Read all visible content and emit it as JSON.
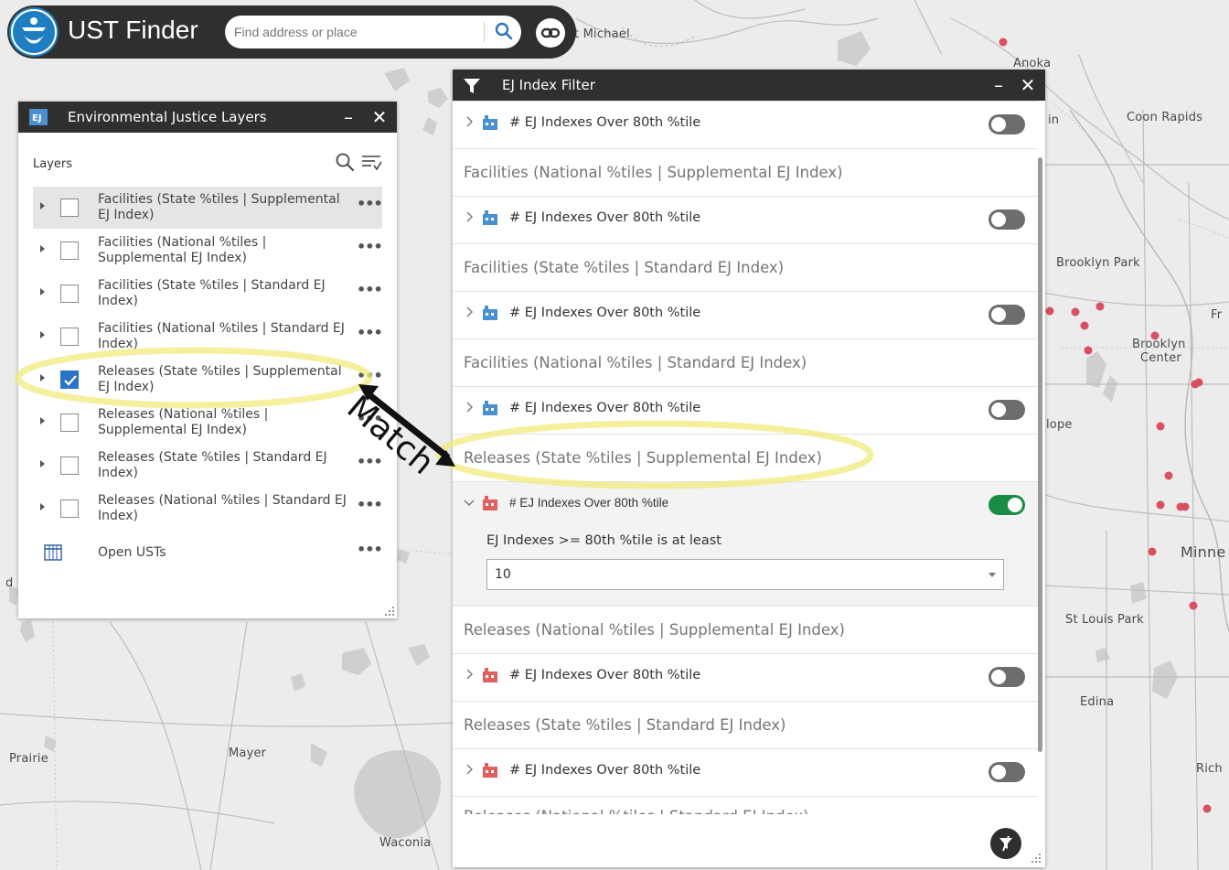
{
  "app": {
    "title": "UST Finder",
    "search_placeholder": "Find address or place"
  },
  "map": {
    "labels": [
      {
        "name": "Saint Michael",
        "text": "t Michael"
      },
      {
        "name": "Anoka",
        "text": "Anoka"
      },
      {
        "name": "Coon Rapids",
        "text": "Coon Rapids"
      },
      {
        "name": "partial-in",
        "text": "in"
      },
      {
        "name": "Brooklyn Park",
        "text": "Brooklyn Park"
      },
      {
        "name": "partial-fr",
        "text": "Fr"
      },
      {
        "name": "Brooklyn Center line 1",
        "text": "Brooklyn"
      },
      {
        "name": "Brooklyn Center line 2",
        "text": "Center"
      },
      {
        "name": "New Hope partial",
        "text": "lope"
      },
      {
        "name": "Minneapolis partial",
        "text": "Minne"
      },
      {
        "name": "St Louis Park",
        "text": "St Louis Park"
      },
      {
        "name": "Edina",
        "text": "Edina"
      },
      {
        "name": "Richfield partial",
        "text": "Rich"
      },
      {
        "name": "Mayer",
        "text": "Mayer"
      },
      {
        "name": "Prairie partial",
        "text": "Prairie"
      },
      {
        "name": "Waconia",
        "text": "Waconia"
      },
      {
        "name": "partial-d",
        "text": "d"
      }
    ],
    "point_color": "#d9505f"
  },
  "layers_panel": {
    "title": "Environmental Justice Layers",
    "logo_text": "EJ",
    "minimize": "–",
    "close": "✕",
    "section_label": "Layers",
    "layers": [
      {
        "label": "Facilities (State %tiles | Supplemental EJ Index)",
        "checked": false
      },
      {
        "label": "Facilities (National %tiles | Supplemental EJ Index)",
        "checked": false
      },
      {
        "label": "Facilities (State %tiles | Standard EJ Index)",
        "checked": false
      },
      {
        "label": "Facilities (National %tiles | Standard EJ Index)",
        "checked": false
      },
      {
        "label": "Releases (State %tiles | Supplemental EJ Index)",
        "checked": true
      },
      {
        "label": "Releases (National %tiles | Supplemental EJ Index)",
        "checked": false
      },
      {
        "label": "Releases (State %tiles | Standard EJ Index)",
        "checked": false
      },
      {
        "label": "Releases (National %tiles | Standard EJ Index)",
        "checked": false
      }
    ],
    "table_layer": {
      "label": "Open USTs"
    },
    "more_label": "•••"
  },
  "filter_panel": {
    "title": "EJ Index Filter",
    "minimize": "–",
    "close": "✕",
    "filter_label": "# EJ Indexes Over 80th %tile",
    "groups": [
      {
        "title": "",
        "enabled": false,
        "type": "facility"
      },
      {
        "title": "Facilities (National %tiles | Supplemental EJ Index)",
        "enabled": false,
        "type": "facility"
      },
      {
        "title": "Facilities (State %tiles | Standard EJ Index)",
        "enabled": false,
        "type": "facility"
      },
      {
        "title": "Facilities (National %tiles | Standard EJ Index)",
        "enabled": false,
        "type": "facility"
      },
      {
        "title": "Releases (State %tiles | Supplemental EJ Index)",
        "enabled": true,
        "type": "release",
        "condition_label": "EJ Indexes >= 80th %tile is at least",
        "condition_value": "10"
      },
      {
        "title": "Releases (National %tiles | Supplemental EJ Index)",
        "enabled": false,
        "type": "release"
      },
      {
        "title": "Releases (State %tiles | Standard EJ Index)",
        "enabled": false,
        "type": "release"
      }
    ],
    "truncated_title": "Releases (National %tiles | Standard EJ Index)"
  },
  "annotation": {
    "text": "Match",
    "highlight_color": "#f3ee8a"
  }
}
